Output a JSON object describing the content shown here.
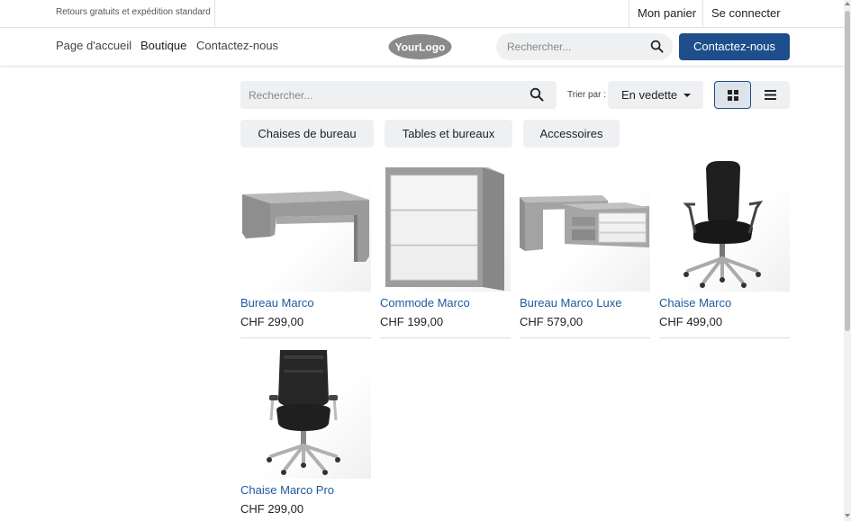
{
  "topbar": {
    "promo": "Retours gratuits et expédition standard",
    "cart": "Mon panier",
    "login": "Se connecter"
  },
  "nav": {
    "items": [
      {
        "label": "Page d'accueil"
      },
      {
        "label": "Boutique"
      },
      {
        "label": "Contactez-nous"
      }
    ],
    "logo_text": "YourLogo",
    "search_placeholder": "Rechercher...",
    "cta": "Contactez-nous"
  },
  "shop": {
    "search_placeholder": "Rechercher...",
    "sort_label": "Trier par :",
    "sort_value": "En vedette",
    "view_mode": "grid",
    "categories": [
      {
        "label": "Chaises de bureau"
      },
      {
        "label": "Tables et bureaux"
      },
      {
        "label": "Accessoires"
      }
    ],
    "products": [
      {
        "name": "Bureau Marco",
        "price": "CHF 299,00",
        "image": "desk-image"
      },
      {
        "name": "Commode Marco",
        "price": "CHF 199,00",
        "image": "drawer-cabinet-image"
      },
      {
        "name": "Bureau Marco Luxe",
        "price": "CHF 579,00",
        "image": "corner-desk-image"
      },
      {
        "name": "Chaise Marco",
        "price": "CHF 499,00",
        "image": "office-chair-image"
      },
      {
        "name": "Chaise Marco Pro",
        "price": "CHF 299,00",
        "image": "executive-chair-image"
      }
    ]
  },
  "colors": {
    "accent": "#1f4e8c",
    "link": "#1f5aa0",
    "field_bg": "#eef0f2"
  }
}
